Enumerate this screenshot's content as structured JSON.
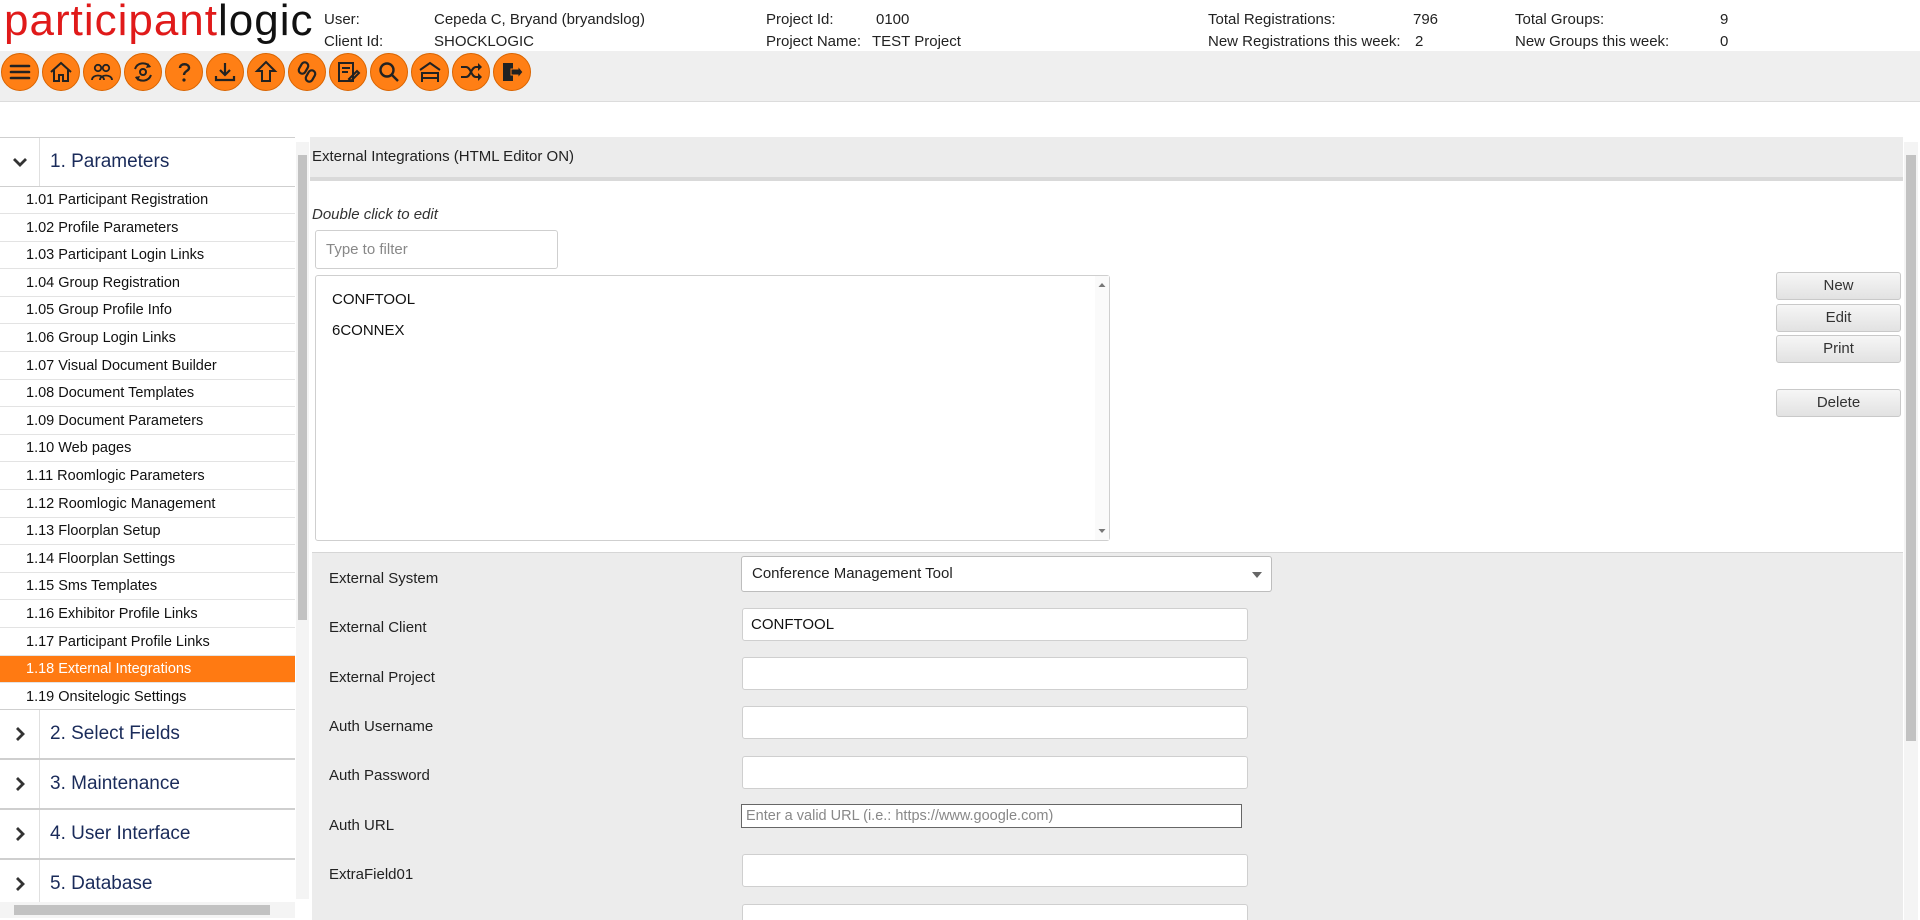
{
  "logo": {
    "part1": "participant",
    "part2": "logic"
  },
  "header": {
    "user_label": "User:",
    "user_value": "Cepeda C, Bryand (bryandslog)",
    "client_label": "Client Id:",
    "client_value": "SHOCKLOGIC",
    "project_id_label": "Project Id:",
    "project_id_value": "0100",
    "project_name_label": "Project Name:",
    "project_name_value": "TEST Project",
    "total_reg_label": "Total Registrations:",
    "total_reg_value": "796",
    "new_reg_label": "New Registrations this week:",
    "new_reg_value": "2",
    "total_groups_label": "Total Groups:",
    "total_groups_value": "9",
    "new_groups_label": "New Groups this week:",
    "new_groups_value": "0"
  },
  "toolbar": {
    "accent": "#ff7f15",
    "icons": [
      "menu-icon",
      "home-icon",
      "groups-icon",
      "sync-icon",
      "help-icon",
      "download-icon",
      "upload-icon",
      "link-icon",
      "edit-doc-icon",
      "search-icon",
      "hotel-icon",
      "shuffle-icon",
      "logout-icon"
    ]
  },
  "sidebar": {
    "accent": "#ff7a12",
    "section1": "1. Parameters",
    "items": [
      "1.01 Participant Registration",
      "1.02 Profile Parameters",
      "1.03 Participant Login Links",
      "1.04 Group Registration",
      "1.05 Group Profile Info",
      "1.06 Group Login Links",
      "1.07 Visual Document Builder",
      "1.08 Document Templates",
      "1.09 Document Parameters",
      "1.10 Web pages",
      "1.11 Roomlogic Parameters",
      "1.12 Roomlogic Management",
      "1.13 Floorplan Setup",
      "1.14 Floorplan Settings",
      "1.15 Sms Templates",
      "1.16 Exhibitor Profile Links",
      "1.17 Participant Profile Links",
      "1.18 External Integrations",
      "1.19 Onsitelogic Settings"
    ],
    "active_index": 17,
    "sections": [
      "2. Select Fields",
      "3. Maintenance",
      "4. User Interface",
      "5. Database"
    ]
  },
  "main": {
    "title": "External Integrations (HTML Editor ON)",
    "hint": "Double click to edit",
    "filter_placeholder": "Type to filter",
    "list": [
      "CONFTOOL",
      "6CONNEX"
    ],
    "buttons": {
      "new": "New",
      "edit": "Edit",
      "print": "Print",
      "delete": "Delete"
    }
  },
  "form": {
    "external_system_label": "External System",
    "external_system_value": "Conference Management Tool",
    "external_client_label": "External Client",
    "external_client_value": "CONFTOOL",
    "external_project_label": "External Project",
    "external_project_value": "",
    "auth_username_label": "Auth Username",
    "auth_username_value": "",
    "auth_password_label": "Auth Password",
    "auth_password_value": "",
    "auth_url_label": "Auth URL",
    "auth_url_placeholder": "Enter a valid URL (i.e.: https://www.google.com)",
    "extra01_label": "ExtraField01",
    "extra01_value": ""
  }
}
